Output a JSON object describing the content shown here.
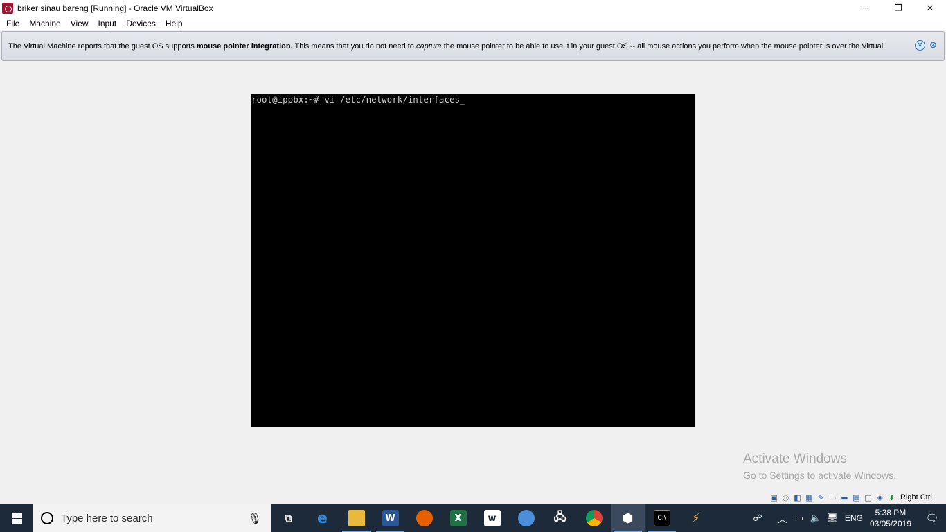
{
  "window": {
    "title": "briker sinau bareng [Running] - Oracle VM VirtualBox",
    "controls": {
      "minimize": "─",
      "restore": "❐",
      "close": "✕"
    }
  },
  "menu": {
    "items": [
      "File",
      "Machine",
      "View",
      "Input",
      "Devices",
      "Help"
    ]
  },
  "notice": {
    "text_before": "The Virtual Machine reports that the guest OS supports ",
    "bold": "mouse pointer integration.",
    "text_middle": " This means that you do not need to ",
    "italic": "capture",
    "text_after": " the mouse pointer to be able to use it in your guest OS -- all mouse actions you perform when the mouse pointer is over the Virtual"
  },
  "console": {
    "line1": "root@ippbx:~# vi /etc/network/interfaces_"
  },
  "watermark": {
    "title": "Activate Windows",
    "subtitle": "Go to Settings to activate Windows."
  },
  "vbox_status": {
    "host_key": "Right Ctrl"
  },
  "taskbar": {
    "search_placeholder": "Type here to search",
    "apps": [
      "task-view",
      "edge",
      "file-explorer",
      "word",
      "firefox",
      "excel",
      "wordpad-w",
      "app-blue",
      "network-app",
      "chrome",
      "virtualbox",
      "cmd",
      "winamp"
    ],
    "tray": {
      "language": "ENG",
      "time": "5:38 PM",
      "date": "03/05/2019"
    }
  },
  "colors": {
    "taskbar_bg": "#1c2a3a",
    "vm_screen_bg": "#000000",
    "console_text": "#c8c8c8",
    "notice_bg": "#dde1e6"
  }
}
